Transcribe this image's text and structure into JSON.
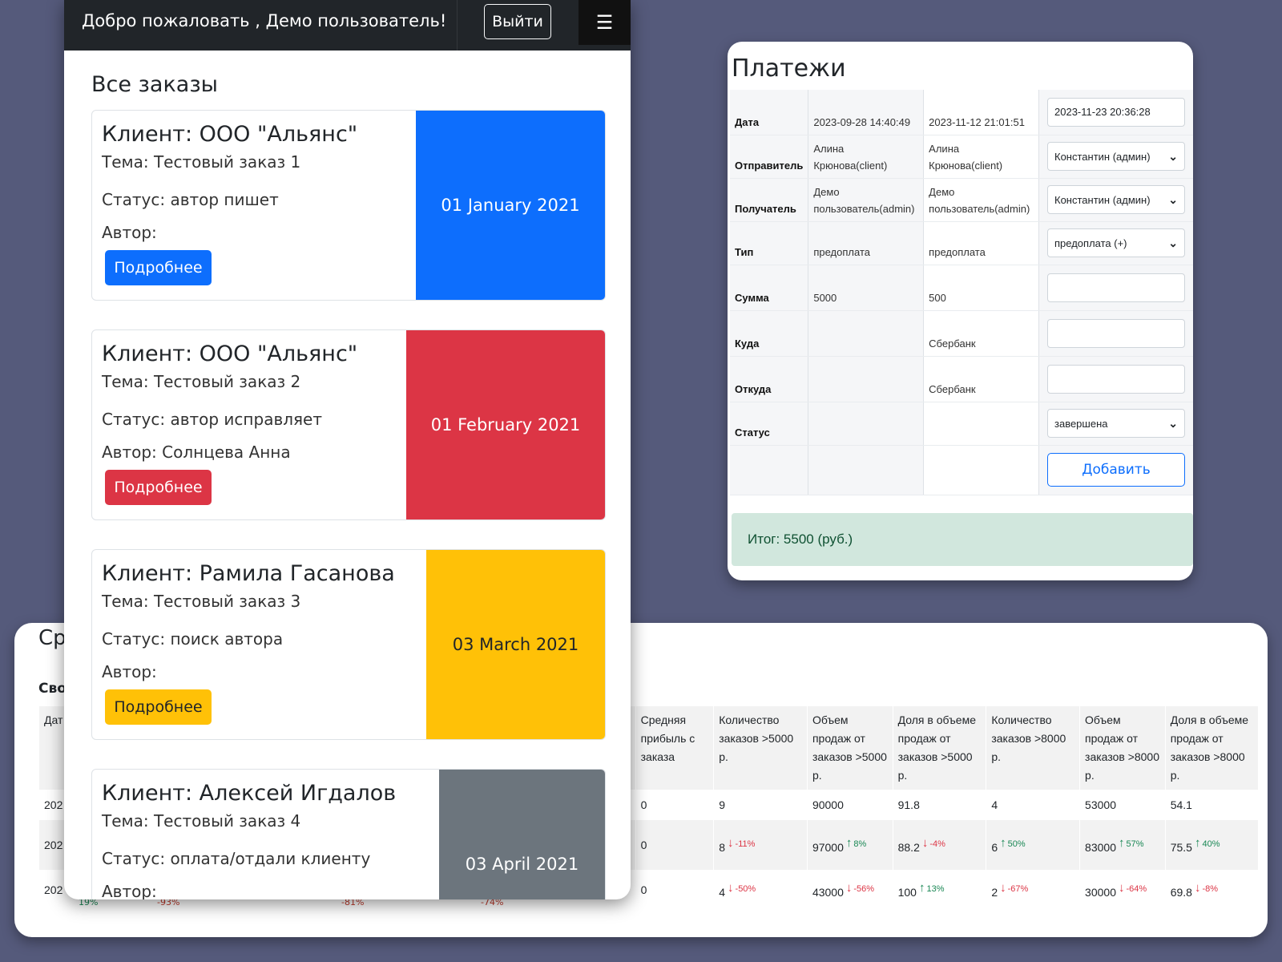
{
  "stats": {
    "title": "Ср",
    "subtitle": "Сво",
    "headers": [
      "Дат",
      "",
      "",
      "",
      "",
      "Средняя прибыль с заказа",
      "Количество заказов >5000 р.",
      "Объем продаж от заказов >5000 р.",
      "Доля в объеме продаж от заказов >5000 р.",
      "Количество заказов >8000 р.",
      "Объем продаж от заказов >8000 р.",
      "Доля в объеме продаж от заказов >8000 р."
    ],
    "rows": [
      {
        "date": "202",
        "profit": "0",
        "cnt5": "9",
        "cnt5_d": "",
        "vol5": "90000",
        "vol5_d": "",
        "share5": "91.8",
        "share5_d": "",
        "cnt8": "4",
        "cnt8_d": "",
        "vol8": "53000",
        "vol8_d": "",
        "share8": "54.1",
        "share8_d": ""
      },
      {
        "date": "202",
        "profit": "0",
        "cnt5": "8",
        "cnt5_d": "-11%",
        "vol5": "97000",
        "vol5_d": "8%",
        "share5": "88.2",
        "share5_d": "-4%",
        "cnt8": "6",
        "cnt8_d": "50%",
        "vol8": "83000",
        "vol8_d": "57%",
        "share8": "75.5",
        "share8_d": "40%"
      },
      {
        "date": "202",
        "profit": "0",
        "cnt5": "4",
        "cnt5_d": "-50%",
        "vol5": "43000",
        "vol5_d": "-56%",
        "share5": "100",
        "share5_d": "13%",
        "cnt8": "2",
        "cnt8_d": "-67%",
        "vol8": "30000",
        "vol8_d": "-64%",
        "share8": "69.8",
        "share8_d": "-8%"
      }
    ],
    "ghost": [
      "19%",
      "-93%",
      "-81%",
      "-74%"
    ]
  },
  "nav": {
    "welcome": "Добро пожаловать , Демо пользователь!",
    "logout": "Выйти",
    "menu_icon": "☰"
  },
  "orders": {
    "title": "Все заказы",
    "more_label": "Подробнее",
    "items": [
      {
        "client": "Клиент: ООО \"Альянс\"",
        "topic": "Тема: Тестовый заказ 1",
        "status": "Статус: автор пишет",
        "author": "Автор:",
        "date": "01 January 2021",
        "color": "#0d6efd"
      },
      {
        "client": "Клиент: ООО \"Альянс\"",
        "topic": "Тема: Тестовый заказ 2",
        "status": "Статус: автор исправляет",
        "author": "Автор: Солнцева Анна",
        "date": "01 February 2021",
        "color": "#dc3545"
      },
      {
        "client": "Клиент: Рамила Гасанова",
        "topic": "Тема: Тестовый заказ 3",
        "status": "Статус: поиск автора",
        "author": "Автор:",
        "date": "03 March 2021",
        "color": "#ffc107"
      },
      {
        "client": "Клиент: Алексей Игдалов",
        "topic": "Тема: Тестовый заказ 4",
        "status": "Статус: оплата/отдали клиенту",
        "author": "Автор:",
        "date": "03 April 2021",
        "color": "#6c757d"
      }
    ]
  },
  "payments": {
    "title": "Платежи",
    "labels": {
      "date": "Дата",
      "sender": "Отправитель",
      "receiver": "Получатель",
      "type": "Тип",
      "amount": "Сумма",
      "to": "Куда",
      "from": "Откуда",
      "status": "Статус"
    },
    "records": [
      {
        "date": "2023-09-28 14:40:49",
        "sender": "Алина Крюнова(client)",
        "receiver": "Демо пользователь(admin)",
        "type": "предоплата",
        "amount": "5000",
        "to": "",
        "from": "",
        "status": ""
      },
      {
        "date": "2023-11-12 21:01:51",
        "sender": "Алина Крюнова(client)",
        "receiver": "Демо пользователь(admin)",
        "type": "предоплата",
        "amount": "500",
        "to": "Сбербанк",
        "from": "Сбербанк",
        "status": ""
      }
    ],
    "form": {
      "date": "2023-11-23 20:36:28",
      "sender": "Константин (админ)",
      "receiver": "Константин (админ)",
      "type": "предоплата (+)",
      "amount": "",
      "to": "",
      "from": "",
      "status": "завершена",
      "add_label": "Добавить"
    },
    "total": "Итог: 5500 (руб.)"
  }
}
